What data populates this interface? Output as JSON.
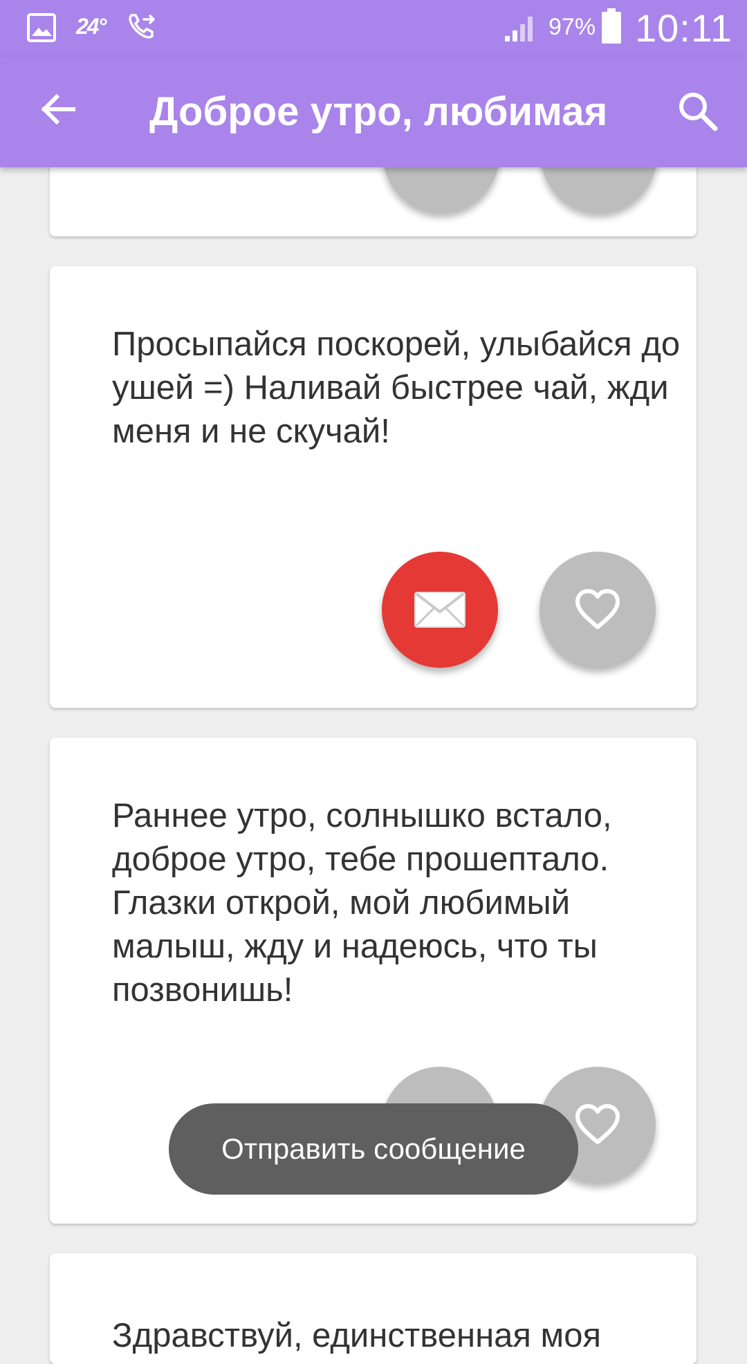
{
  "status_bar": {
    "temperature": "24°",
    "battery_percent": "97%",
    "time": "10:11",
    "icons": [
      "gallery-icon",
      "call-forward-icon",
      "signal-icon",
      "battery-icon"
    ]
  },
  "app_bar": {
    "title": "Доброе утро, любимая",
    "back_icon": "arrow-left-icon",
    "search_icon": "search-icon"
  },
  "cards": [
    {
      "text": ""
    },
    {
      "text": "Просыпайся поскорей, улыбайся до ушей =) Наливай быстрее чай, жди меня и не скучай!"
    },
    {
      "text": "Раннее утро, солнышко встало, доброе утро, тебе прошептало. Глазки открой, мой любимый малыш, жду и надеюсь, что ты позвонишь!"
    },
    {
      "text": "Здравствуй, единственная моя"
    }
  ],
  "toast": {
    "text": "Отправить сообщение"
  },
  "colors": {
    "primary": "#a984ea",
    "send_button": "#e53935",
    "favorite_button": "#bdbdbd",
    "toast_background": "#5f5f5f"
  }
}
